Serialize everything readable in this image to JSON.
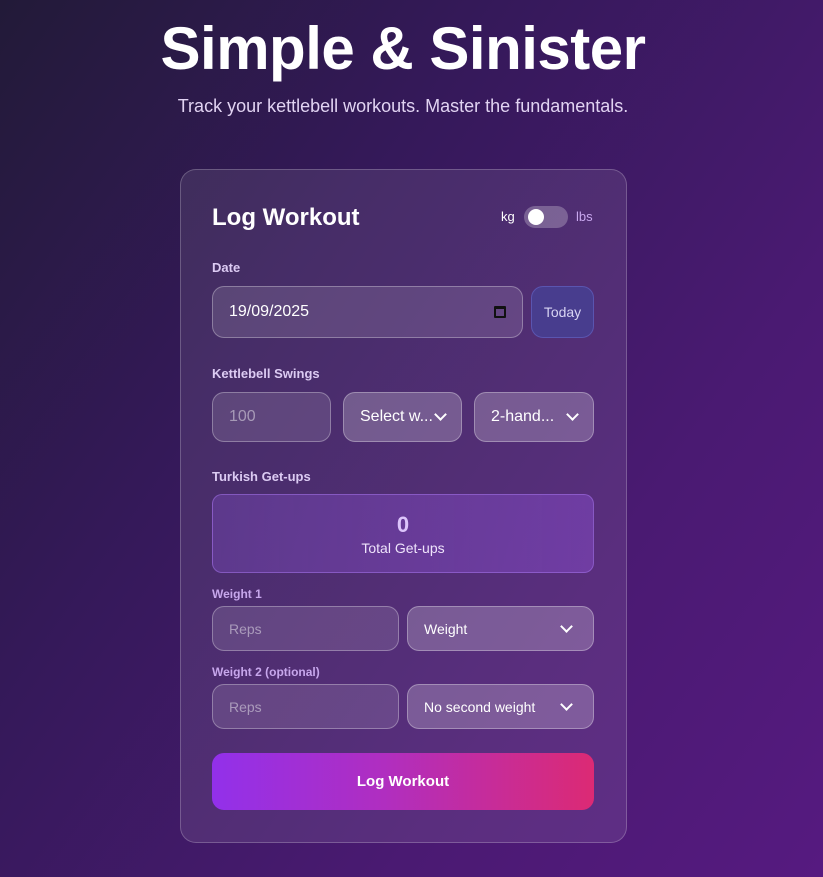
{
  "header": {
    "title": "Simple & Sinister",
    "subtitle": "Track your kettlebell workouts. Master the fundamentals."
  },
  "form": {
    "title": "Log Workout",
    "unit_toggle": {
      "left": "kg",
      "right": "lbs",
      "selected": "kg"
    },
    "date": {
      "label": "Date",
      "value": "19/09/2025",
      "today_label": "Today"
    },
    "swings": {
      "label": "Kettlebell Swings",
      "reps_placeholder": "100",
      "weight_select": "Select w...",
      "type_select": "2-hand..."
    },
    "getups": {
      "label": "Turkish Get-ups",
      "total": "0",
      "total_label": "Total Get-ups",
      "weight1": {
        "label": "Weight 1",
        "reps_placeholder": "Reps",
        "weight_select": "Weight"
      },
      "weight2": {
        "label": "Weight 2 (optional)",
        "reps_placeholder": "Reps",
        "weight_select": "No second weight"
      }
    },
    "submit_label": "Log Workout"
  },
  "colors": {
    "accent_start": "#9230ea",
    "accent_end": "#dc2a74",
    "today_button": "#483d8e"
  }
}
